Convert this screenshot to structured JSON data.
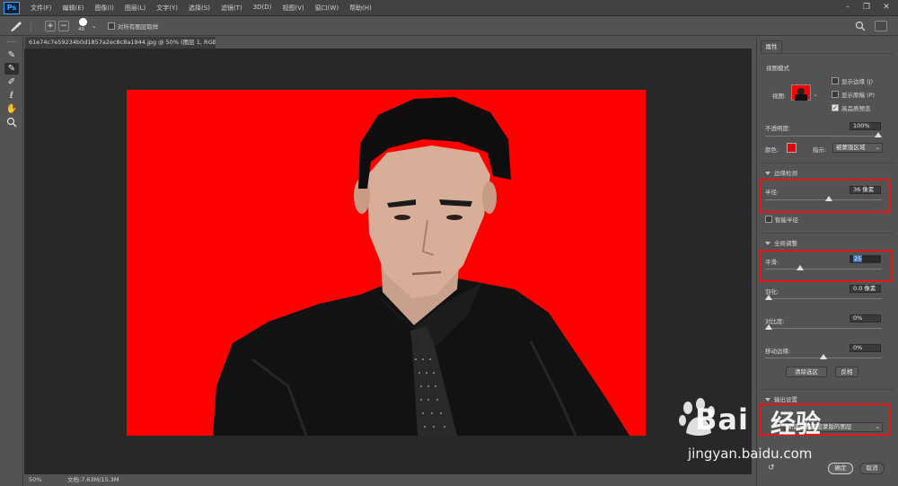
{
  "app": {
    "logo": "Ps"
  },
  "menu": [
    "文件(F)",
    "编辑(E)",
    "图像(I)",
    "图层(L)",
    "文字(Y)",
    "选择(S)",
    "滤镜(T)",
    "3D(D)",
    "视图(V)",
    "窗口(W)",
    "帮助(H)"
  ],
  "window_controls": [
    "–",
    "❐",
    "✕"
  ],
  "options_bar": {
    "brush_size": "40",
    "sample_all_layers": "对所有图层取样"
  },
  "document": {
    "tab_title": "61e74c7e59234b0d1857a2ec8c8a1944.jpg @ 50% (图层 1, RGB/8#) *",
    "close": "×"
  },
  "status": {
    "zoom": "50%",
    "doc_size": "文档:7.63M/15.3M"
  },
  "panel": {
    "tab": "属性",
    "view_mode": {
      "title": "视图模式",
      "view_label": "视图:",
      "show_edge": "显示边缘 (J)",
      "show_original": "显示原稿 (P)",
      "high_quality": "高品质预览"
    },
    "opacity": {
      "label": "不透明度:",
      "value": "100%"
    },
    "color": {
      "label": "颜色:",
      "swatch": "#e8000b",
      "indicates_label": "指示:",
      "indicates_value": "被蒙版区域"
    },
    "edge_detection": {
      "title": "边缘检测",
      "radius_label": "半径:",
      "radius_value": "36 像素",
      "smart_radius": "智能半径"
    },
    "global_refine": {
      "title": "全局调整",
      "smooth_label": "平滑:",
      "smooth_value": "25",
      "feather_label": "羽化:",
      "feather_value": "0.0 像素",
      "contrast_label": "对比度:",
      "contrast_value": "0%",
      "shift_label": "移动边缘:",
      "shift_value": "0%",
      "clear_btn": "清除选区",
      "invert_btn": "反相"
    },
    "output": {
      "title": "输出设置",
      "output_to": "新建带有图层蒙版的图层"
    },
    "ok": "确定",
    "cancel": "取消"
  },
  "watermark": {
    "brand": "Bai",
    "brand2": "经验",
    "url": "jingyan.baidu.com"
  }
}
